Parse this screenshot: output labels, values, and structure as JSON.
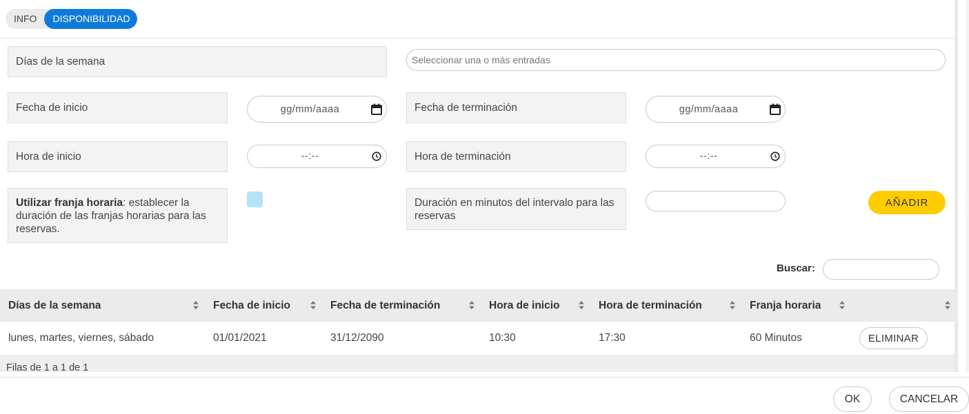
{
  "tabs": [
    {
      "label": "INFO",
      "active": false
    },
    {
      "label": "DISPONIBILIDAD",
      "active": true
    }
  ],
  "form": {
    "weekdays_label": "Días de la semana",
    "weekdays_placeholder": "Seleccionar una o más entradas",
    "start_date_label": "Fecha de inicio",
    "start_date_value": "gg/mm/aaaa",
    "end_date_label": "Fecha de terminación",
    "end_date_value": "gg/mm/aaaa",
    "start_time_label": "Hora de inicio",
    "start_time_value": "--:--",
    "end_time_label": "Hora de terminación",
    "end_time_value": "--:--",
    "slot_label_bold": "Utilizar franja horaria",
    "slot_label_rest": ": establecer la duración de las franjas horarias para las reservas.",
    "slot_checked": false,
    "interval_label": "Duración en minutos del intervalo para las reservas",
    "interval_value": "",
    "add_button": "AÑADIR"
  },
  "search": {
    "label": "Buscar:",
    "value": ""
  },
  "table": {
    "columns": [
      "Días de la semana",
      "Fecha de inicio",
      "Fecha de terminación",
      "Hora de inicio",
      "Hora de terminación",
      "Franja horaria",
      ""
    ],
    "rows": [
      {
        "weekdays": "lunes, martes, viernes, sábado",
        "start_date": "01/01/2021",
        "end_date": "31/12/2090",
        "start_time": "10:30",
        "end_time": "17:30",
        "slot": "60 Minutos",
        "action": "ELIMINAR"
      }
    ],
    "footer": "Filas de 1 a 1 de 1"
  },
  "dialog": {
    "ok_label": "OK",
    "cancel_label": "CANCELAR"
  },
  "colors": {
    "accent": "#0f7ad9",
    "add_button": "#ffcc00",
    "checkbox": "#b3e3f5"
  }
}
